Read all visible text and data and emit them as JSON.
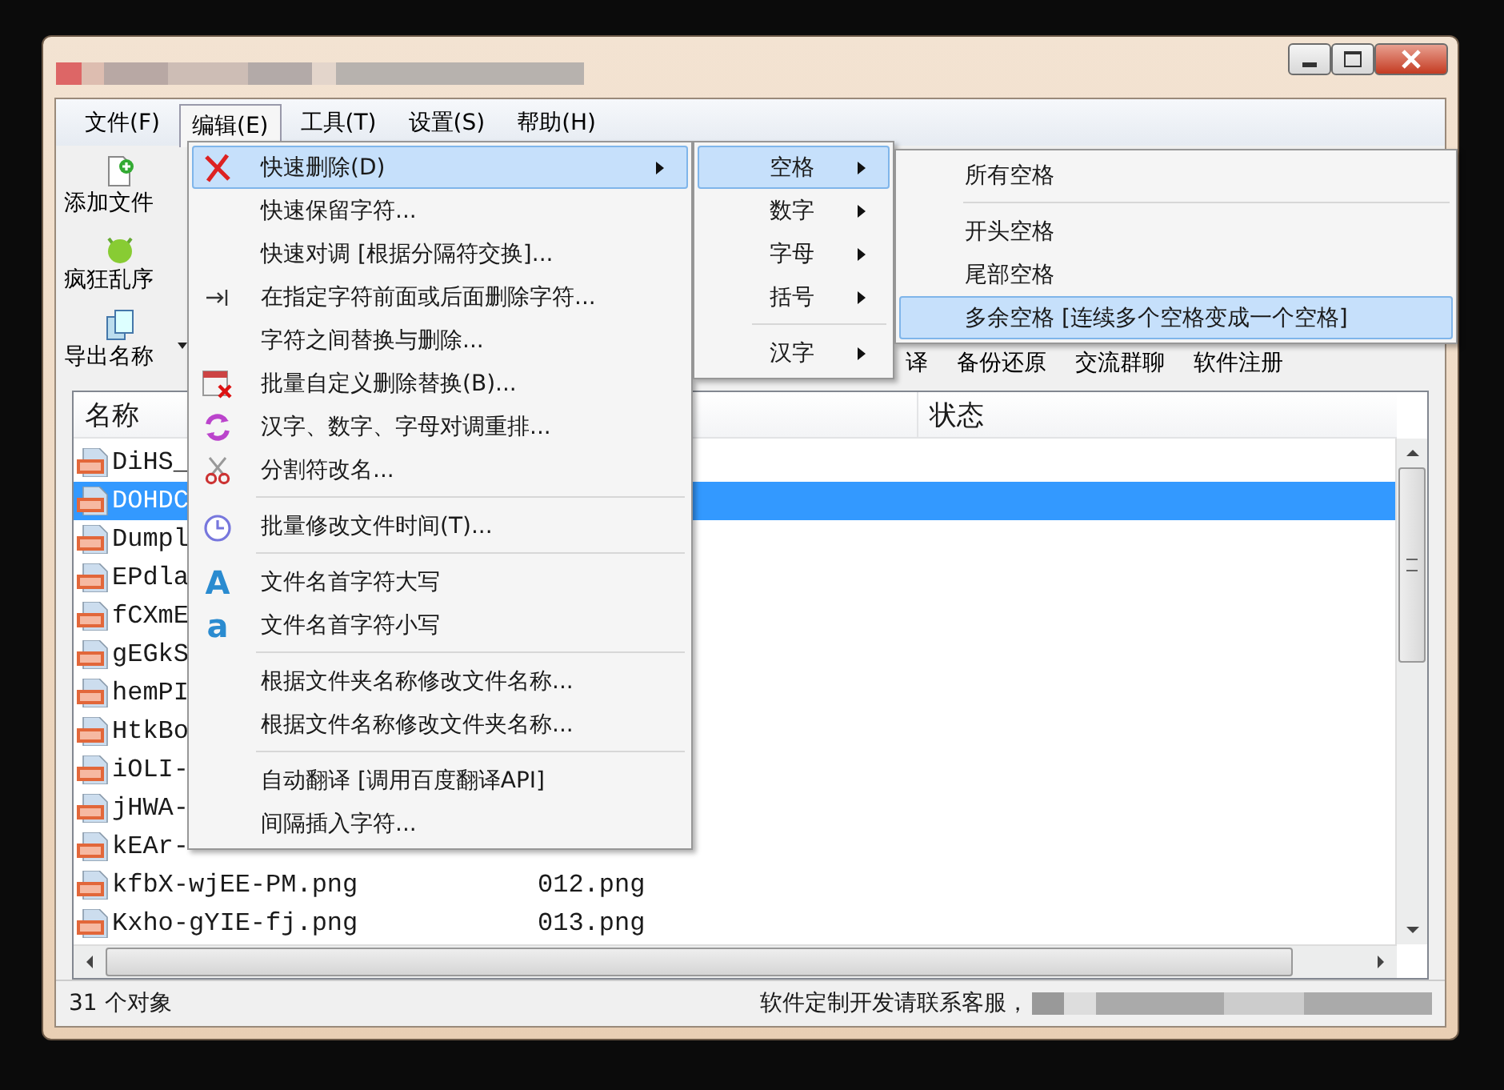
{
  "menu_bar": [
    {
      "label": "文件(F)",
      "selected": false
    },
    {
      "label": "编辑(E)",
      "selected": true
    },
    {
      "label": "工具(T)",
      "selected": false
    },
    {
      "label": "设置(S)",
      "selected": false
    },
    {
      "label": "帮助(H)",
      "selected": false
    }
  ],
  "toolbar_left": [
    {
      "label": "添加文件",
      "dropdown": false
    },
    {
      "label": "疯狂乱序",
      "dropdown": false
    },
    {
      "label": "导出名称",
      "dropdown": true
    }
  ],
  "toolbar_top": [
    "译",
    "备份还原",
    "交流群聊",
    "软件注册"
  ],
  "file_list": {
    "columns": [
      "名称",
      "状态"
    ],
    "rows": [
      {
        "name": "DiHS_",
        "selected": false
      },
      {
        "name": "DOHDC",
        "selected": true
      },
      {
        "name": "Dumpl",
        "selected": false
      },
      {
        "name": "EPdla",
        "selected": false
      },
      {
        "name": "fCXmE",
        "selected": false
      },
      {
        "name": "gEGkS",
        "selected": false
      },
      {
        "name": "hemPI",
        "selected": false
      },
      {
        "name": "HtkBo",
        "selected": false
      },
      {
        "name": "iOLI-",
        "selected": false
      },
      {
        "name": "jHWA-",
        "selected": false
      },
      {
        "name": "kEAr-",
        "selected": false
      },
      {
        "name": "kfbX-wjEE-PM.png",
        "column_2": "012.png",
        "selected": false
      },
      {
        "name": "Kxho-gYIE-fj.png",
        "column_2": "013.png",
        "selected": false
      }
    ]
  },
  "status_bar": {
    "count": "31 个对象",
    "message": "软件定制开发请联系客服，"
  },
  "edit_menu": [
    {
      "kind": "item",
      "label": "快速删除(D)",
      "submenu": true,
      "selected": true
    },
    {
      "kind": "item",
      "label": "快速保留字符...",
      "submenu": false,
      "selected": false
    },
    {
      "kind": "item",
      "label": "快速对调 [根据分隔符交换]...",
      "submenu": false,
      "selected": false
    },
    {
      "kind": "item",
      "label": "在指定字符前面或后面删除字符...",
      "submenu": false,
      "selected": false
    },
    {
      "kind": "item",
      "label": "字符之间替换与删除...",
      "submenu": false,
      "selected": false
    },
    {
      "kind": "item",
      "label": "批量自定义删除替换(B)...",
      "submenu": false,
      "selected": false
    },
    {
      "kind": "item",
      "label": "汉字、数字、字母对调重排...",
      "submenu": false,
      "selected": false
    },
    {
      "kind": "item",
      "label": "分割符改名...",
      "submenu": false,
      "selected": false
    },
    {
      "kind": "separator"
    },
    {
      "kind": "item",
      "label": "批量修改文件时间(T)...",
      "submenu": false,
      "selected": false
    },
    {
      "kind": "separator"
    },
    {
      "kind": "item",
      "label": "文件名首字符大写",
      "glyph": "A",
      "submenu": false,
      "selected": false
    },
    {
      "kind": "item",
      "label": "文件名首字符小写",
      "glyph": "a",
      "submenu": false,
      "selected": false
    },
    {
      "kind": "separator"
    },
    {
      "kind": "item",
      "label": "根据文件夹名称修改文件名称...",
      "submenu": false,
      "selected": false
    },
    {
      "kind": "item",
      "label": "根据文件名称修改文件夹名称...",
      "submenu": false,
      "selected": false
    },
    {
      "kind": "separator"
    },
    {
      "kind": "item",
      "label": "自动翻译 [调用百度翻译API]",
      "submenu": false,
      "selected": false
    },
    {
      "kind": "item",
      "label": "间隔插入字符...",
      "submenu": false,
      "selected": false
    }
  ],
  "delete_submenu": [
    {
      "kind": "item",
      "label": "空格",
      "submenu": true,
      "selected": true
    },
    {
      "kind": "item",
      "label": "数字",
      "submenu": true,
      "selected": false
    },
    {
      "kind": "item",
      "label": "字母",
      "submenu": true,
      "selected": false
    },
    {
      "kind": "item",
      "label": "括号",
      "submenu": true,
      "selected": false
    },
    {
      "kind": "separator"
    },
    {
      "kind": "item",
      "label": "汉字",
      "submenu": true,
      "selected": false
    }
  ],
  "space_submenu": [
    {
      "kind": "item",
      "label": "所有空格",
      "submenu": false,
      "selected": false
    },
    {
      "kind": "separator"
    },
    {
      "kind": "item",
      "label": "开头空格",
      "submenu": false,
      "selected": false
    },
    {
      "kind": "item",
      "label": "尾部空格",
      "submenu": false,
      "selected": false
    },
    {
      "kind": "item",
      "label": "多余空格 [连续多个空格变成一个空格]",
      "submenu": false,
      "selected": true
    }
  ]
}
